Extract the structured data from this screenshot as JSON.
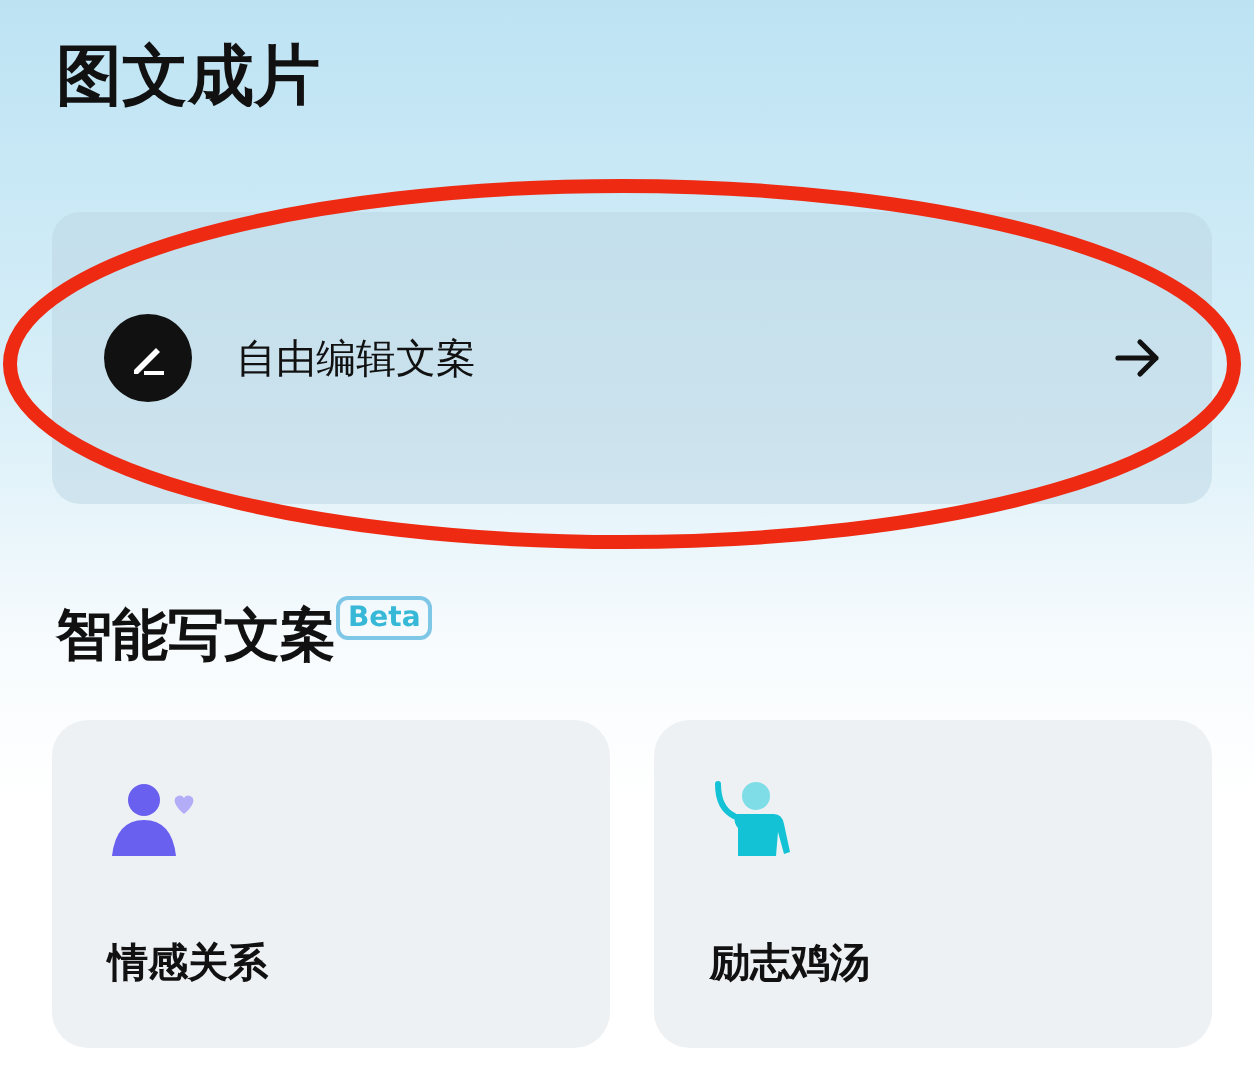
{
  "title": "图文成片",
  "free_edit": {
    "label": "自由编辑文案"
  },
  "section": {
    "title": "智能写文案",
    "badge": "Beta"
  },
  "categories": [
    {
      "label": "情感关系",
      "kind": "relation"
    },
    {
      "label": "励志鸡汤",
      "kind": "cheer"
    }
  ]
}
